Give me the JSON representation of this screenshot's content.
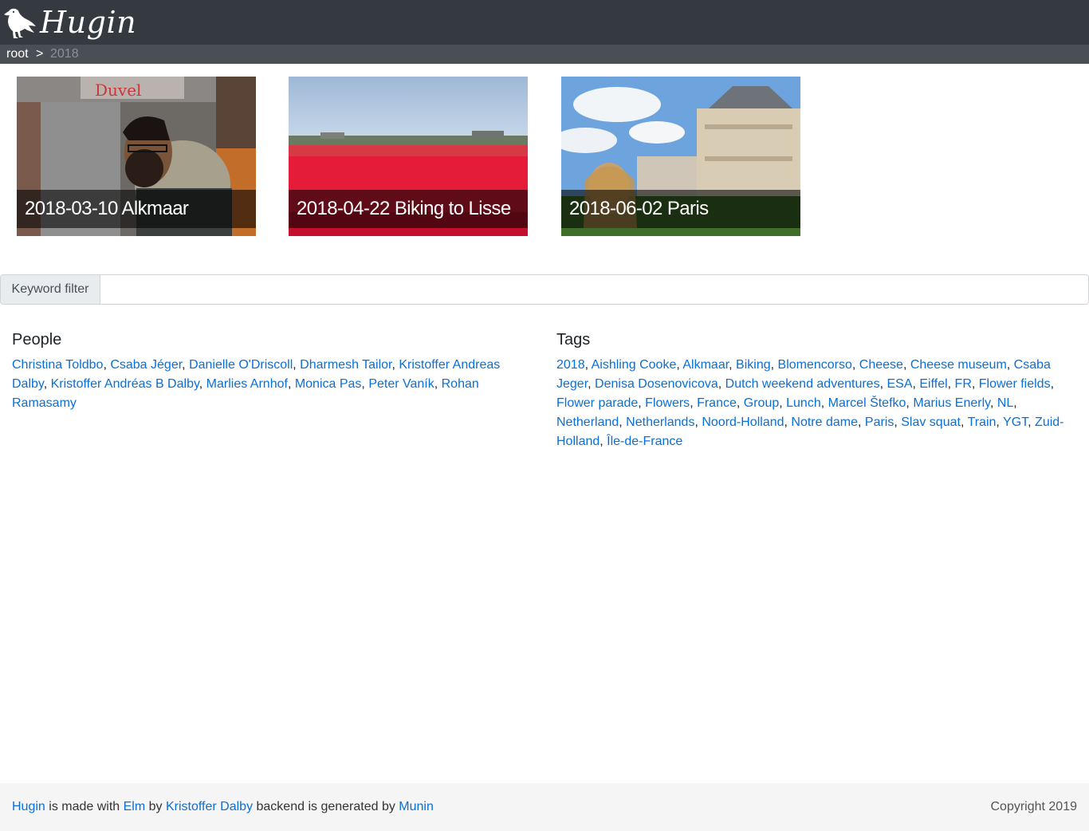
{
  "app": {
    "title": "Hugin"
  },
  "breadcrumb": {
    "root": "root",
    "separator": ">",
    "current": "2018"
  },
  "albums": [
    {
      "caption": "2018-03-10 Alkmaar"
    },
    {
      "caption": "2018-04-22 Biking to Lisse"
    },
    {
      "caption": "2018-06-02 Paris"
    }
  ],
  "filter": {
    "label": "Keyword filter",
    "value": "",
    "placeholder": ""
  },
  "people": {
    "title": "People",
    "items": [
      "Christina Toldbo",
      "Csaba Jéger",
      "Danielle O'Driscoll",
      "Dharmesh Tailor",
      "Kristoffer Andreas Dalby",
      "Kristoffer Andréas B Dalby",
      "Marlies Arnhof",
      "Monica Pas",
      "Peter Vaník",
      "Rohan Ramasamy"
    ]
  },
  "tags": {
    "title": "Tags",
    "items": [
      "2018",
      "Aishling Cooke",
      "Alkmaar",
      "Biking",
      "Blomencorso",
      "Cheese",
      "Cheese museum",
      "Csaba Jeger",
      "Denisa Dosenovicova",
      "Dutch weekend adventures",
      "ESA",
      "Eiffel",
      "FR",
      "Flower fields",
      "Flower parade",
      "Flowers",
      "France",
      "Group",
      "Lunch",
      "Marcel Štefko",
      "Marius Enerly",
      "NL",
      "Netherland",
      "Netherlands",
      "Noord-Holland",
      "Notre dame",
      "Paris",
      "Slav squat",
      "Train",
      "YGT",
      "Zuid-Holland",
      "Île-de-France"
    ]
  },
  "footer": {
    "hugin": "Hugin",
    "made_with": " is made with ",
    "elm": "Elm",
    "by": " by ",
    "author": "Kristoffer Dalby",
    "backend": " backend is generated by ",
    "munin": "Munin",
    "copyright": "Copyright 2019"
  }
}
